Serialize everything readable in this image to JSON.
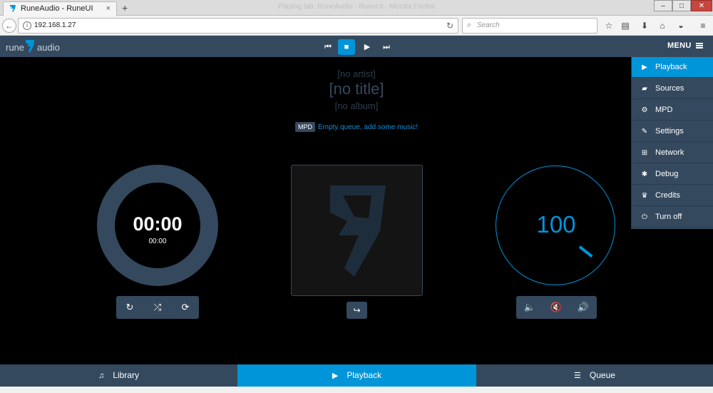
{
  "browser": {
    "tab_title": "RuneAudio - RuneUI",
    "tab_close": "×",
    "new_tab": "+",
    "ghost_title": "Playing tab: RuneAudio - RuneUI - Mozilla Firefox",
    "window_controls": {
      "minimize": "–",
      "maximize": "□",
      "close": "✕"
    },
    "url": "192.168.1.27",
    "search_placeholder": "Search"
  },
  "app": {
    "logo_left": "rune",
    "logo_right": "audio",
    "transport": {
      "prev": "⏮",
      "stop": "■",
      "play": "▶",
      "next": "⏭"
    },
    "menu_label": "MENU",
    "track": {
      "artist": "[no artist]",
      "title": "[no title]",
      "album": "[no album]"
    },
    "status": {
      "badge": "MPD",
      "message": "Empty queue, add some music!"
    },
    "time": {
      "elapsed": "00:00",
      "total": "00:00"
    },
    "volume": {
      "value": "100",
      "level": 100
    },
    "menu_items": [
      {
        "label": "Playback",
        "icon": "play-icon",
        "glyph": "▶"
      },
      {
        "label": "Sources",
        "icon": "folder-icon",
        "glyph": "▰"
      },
      {
        "label": "MPD",
        "icon": "cogs-icon",
        "glyph": "⚙"
      },
      {
        "label": "Settings",
        "icon": "wrench-icon",
        "glyph": "✎"
      },
      {
        "label": "Network",
        "icon": "sitemap-icon",
        "glyph": "⊞"
      },
      {
        "label": "Debug",
        "icon": "bug-icon",
        "glyph": "✱"
      },
      {
        "label": "Credits",
        "icon": "trophy-icon",
        "glyph": "♛"
      },
      {
        "label": "Turn off",
        "icon": "power-icon",
        "glyph": "⏻"
      }
    ],
    "tabs": [
      {
        "label": "Library",
        "icon": "music-icon",
        "glyph": "♫"
      },
      {
        "label": "Playback",
        "icon": "play-icon",
        "glyph": "▶"
      },
      {
        "label": "Queue",
        "icon": "list-icon",
        "glyph": "☰"
      }
    ],
    "colors": {
      "accent": "#0095d8",
      "panel": "#34495e",
      "background": "#000000"
    }
  }
}
